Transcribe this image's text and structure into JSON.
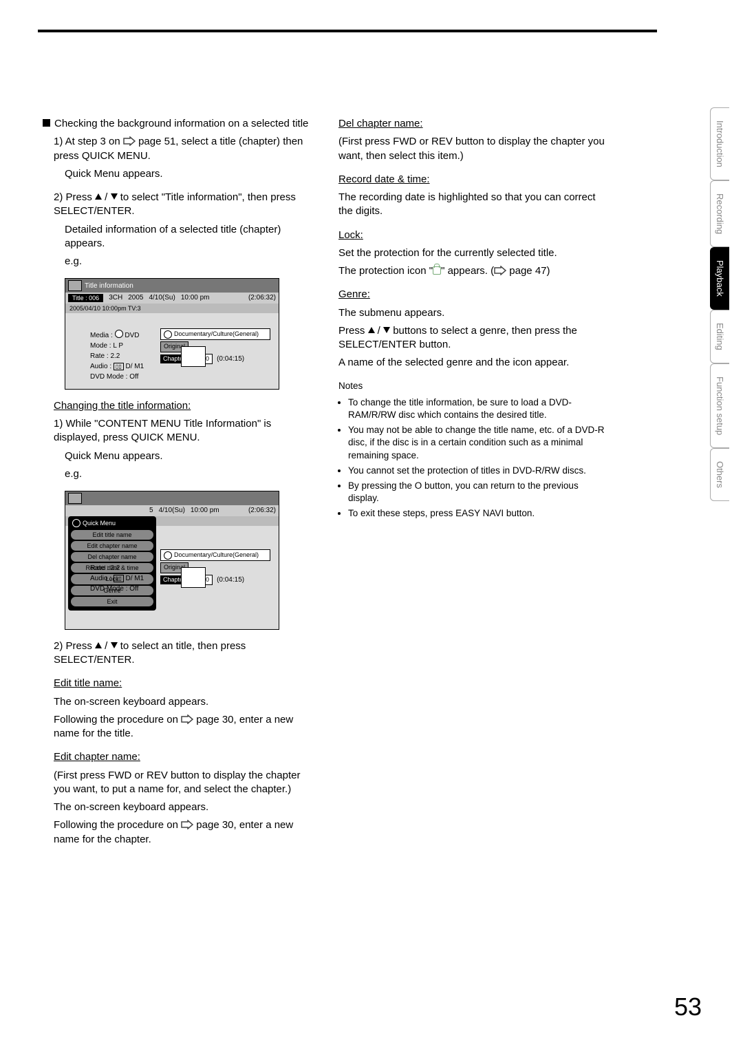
{
  "page_number": "53",
  "side_tabs": [
    "Introduction",
    "Recording",
    "Playback",
    "Editing",
    "Function setup",
    "Others"
  ],
  "active_tab_index": 2,
  "left": {
    "heading": "Checking the background information on a selected title",
    "step1a": "1) At step 3 on ",
    "step1_page": " page 51, select a title (chapter) then press QUICK MENU.",
    "step1b": "Quick Menu appears.",
    "step2a": "2) Press ",
    "step2b": " to select \"Title information\", then press SELECT/ENTER.",
    "step2c": "Detailed information of a selected title (chapter) appears.",
    "eg": "e.g.",
    "shot1": {
      "header": "Title information",
      "title_chip": "Title : 006",
      "ch": "3CH",
      "year": "2005",
      "date": "4/10(Su)",
      "time": "10:00 pm",
      "dur": "(2:06:32)",
      "row2": "2005/04/10 10:00pm TV:3",
      "media": "Media :",
      "media_v": "DVD",
      "mode": "Mode : L P",
      "rate": "Rate : 2.2",
      "audio": "Audio :",
      "audio_v": "D/ M1",
      "dvdmode": "DVD Mode : Off",
      "cat": "Documentary/Culture(General)",
      "original": "Original",
      "chapter_lbl": "Chapter :",
      "chapter_num": "000",
      "chapter_dur": "(0:04:15)"
    },
    "changing_hdr": "Changing the title information:",
    "chg1a": "1) While \"CONTENT MENU Title Information\" is displayed, press QUICK MENU.",
    "chg1b": "Quick Menu appears.",
    "shot2": {
      "qmenu_hdr": "Quick Menu",
      "items": [
        "Edit title name",
        "Edit chapter name",
        "Del chapter name",
        "Record date & time",
        "Lock",
        "Genre",
        "Exit"
      ],
      "date": "4/10(Su)",
      "time": "10:00 pm",
      "dur": "(2:06:32)",
      "cat": "Documentary/Culture(General)",
      "original": "Original",
      "rate": "Rate : 2.2",
      "audio": "Audio :",
      "audio_v": "D/ M1",
      "dvdmode": "DVD Mode : Off",
      "chapter_lbl": "Chapter :",
      "chapter_num": "000",
      "chapter_dur": "(0:04:15)"
    },
    "chg2a": "2) Press ",
    "chg2b": " to select an title, then press SELECT/ENTER.",
    "edit_title_hdr": "Edit title name:",
    "edit_title_1": "The on-screen keyboard appears.",
    "edit_title_2a": "Following the procedure on ",
    "edit_title_2b": " page 30, enter a new name for the title.",
    "edit_chap_hdr": "Edit chapter name:",
    "edit_chap_1": "(First press FWD or REV button to display the chapter you want, to put a name for, and select the chapter.)",
    "edit_chap_2": "The on-screen keyboard appears.",
    "edit_chap_3a": "Following the procedure on ",
    "edit_chap_3b": " page 30, enter a new name for the chapter."
  },
  "right": {
    "del_hdr": "Del chapter name:",
    "del_1": "(First press FWD or REV button to display the chapter you want, then select this item.)",
    "rec_hdr": "Record date & time:",
    "rec_1": "The recording date is highlighted so that you can correct the digits.",
    "lock_hdr": "Lock:",
    "lock_1": "Set the protection for the currently selected title.",
    "lock_2a": "The protection icon \"",
    "lock_2b": "\" appears. (",
    "lock_2c": " page 47)",
    "genre_hdr": "Genre:",
    "genre_1": "The submenu appears.",
    "genre_2a": "Press ",
    "genre_2b": " buttons to select a genre, then press the SELECT/ENTER button.",
    "genre_3": "A name of the selected genre and the icon appear.",
    "notes_hdr": "Notes",
    "notes": [
      "To change the title information, be sure to load a DVD-RAM/R/RW disc which contains the desired title.",
      "You may not be able to change the title name, etc. of a DVD-R disc, if the disc is in a certain condition such as a minimal remaining space.",
      "You cannot set the protection of titles in DVD-R/RW discs.",
      "By pressing the O button, you can return to the previous display.",
      "To exit these steps, press EASY NAVI button."
    ]
  }
}
